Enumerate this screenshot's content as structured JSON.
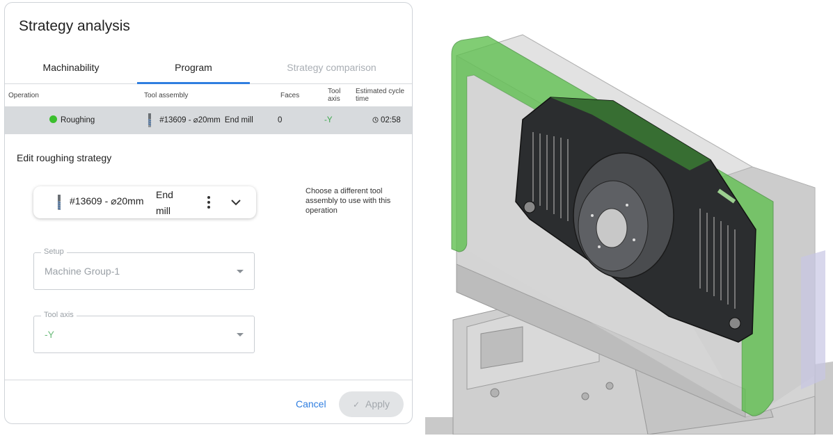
{
  "panel": {
    "title": "Strategy analysis",
    "tabs": [
      {
        "label": "Machinability",
        "state": "normal"
      },
      {
        "label": "Program",
        "state": "active"
      },
      {
        "label": "Strategy comparison",
        "state": "disabled"
      }
    ],
    "columns": {
      "operation": "Operation",
      "tool_assembly": "Tool assembly",
      "faces": "Faces",
      "tool_axis_line1": "Tool",
      "tool_axis_line2": "axis",
      "cycle_line1": "Estimated cycle",
      "cycle_line2": "time"
    },
    "operation_row": {
      "name": "Roughing",
      "status_color": "#3bbf2e",
      "tool": "#13609 - ⌀20mm",
      "tool_type": "End mill",
      "faces": "0",
      "tool_axis": "-Y",
      "cycle_time": "02:58"
    },
    "edit_title": "Edit roughing strategy",
    "tool_card": {
      "tool": "#13609 - ⌀20mm",
      "tool_type_line1": "End",
      "tool_type_line2": "mill",
      "icon": "end-mill-icon"
    },
    "help_text": "Choose a different tool assembly to use with this operation",
    "setup": {
      "label": "Setup",
      "value": "Machine Group-1"
    },
    "tool_axis": {
      "label": "Tool axis",
      "value": "-Y"
    },
    "footer": {
      "cancel": "Cancel",
      "apply": "Apply"
    },
    "colors": {
      "accent": "#2f7ee0",
      "selected_row": "#d7dadd",
      "highlight_green": "#5ec04e"
    }
  }
}
